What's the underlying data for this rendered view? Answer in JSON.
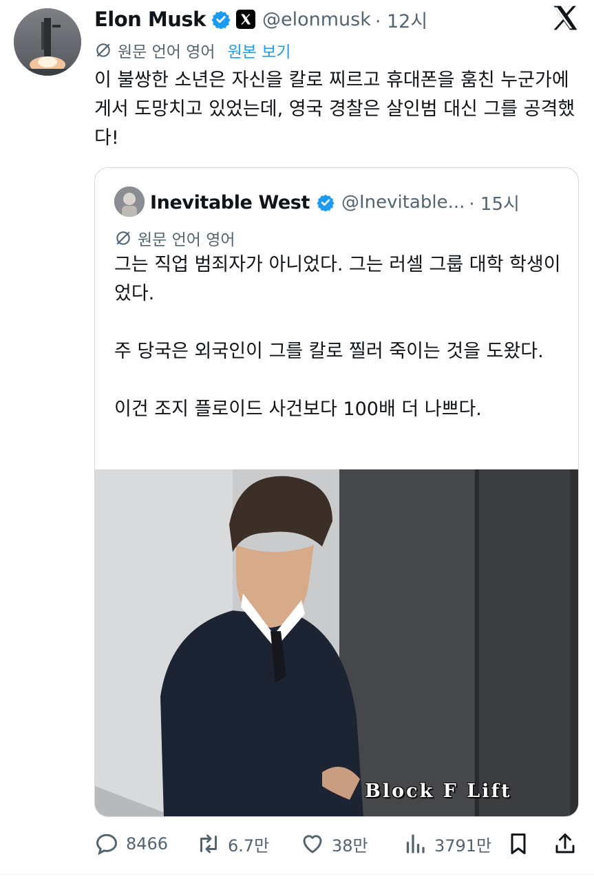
{
  "tweet": {
    "author_name": "Elon Musk",
    "author_handle": "@elonmusk",
    "time": "· 12시",
    "translated_from": "원문 언어 영어",
    "show_original": "원본 보기",
    "text": "이 불쌍한 소년은 자신을 칼로 찌르고 휴대폰을 훔친 누군가에게서 도망치고 있었는데, 영국 경찰은 살인범 대신 그를 공격했다!"
  },
  "quote": {
    "author_name": "Inevitable West",
    "author_handle": "@Inevitable...",
    "time": "· 15시",
    "translated_from": "원문 언어 영어",
    "paragraphs": [
      "그는 직업 범죄자가 아니었다. 그는 러셀 그룹 대학 학생이었다.",
      "주 당국은 외국인이 그를 칼로 찔러 죽이는 것을 도왔다.",
      "이건 조지 플로이드 사건보다 100배 더 나쁘다."
    ],
    "media_overlay_text": "Block F Lift"
  },
  "actions": {
    "replies": "8466",
    "retweets": "6.7만",
    "likes": "38만",
    "views": "3791만"
  },
  "icons": {
    "verified": "verified-badge-icon",
    "x_logo": "x-logo-icon",
    "translate": "translate-icon",
    "close": "x-close-icon",
    "reply": "reply-icon",
    "retweet": "retweet-icon",
    "like": "heart-icon",
    "views": "views-icon",
    "bookmark": "bookmark-icon",
    "share": "share-icon"
  },
  "colors": {
    "accent": "#1d9bf0",
    "secondary_text": "#536471",
    "border": "#cfd9de"
  }
}
